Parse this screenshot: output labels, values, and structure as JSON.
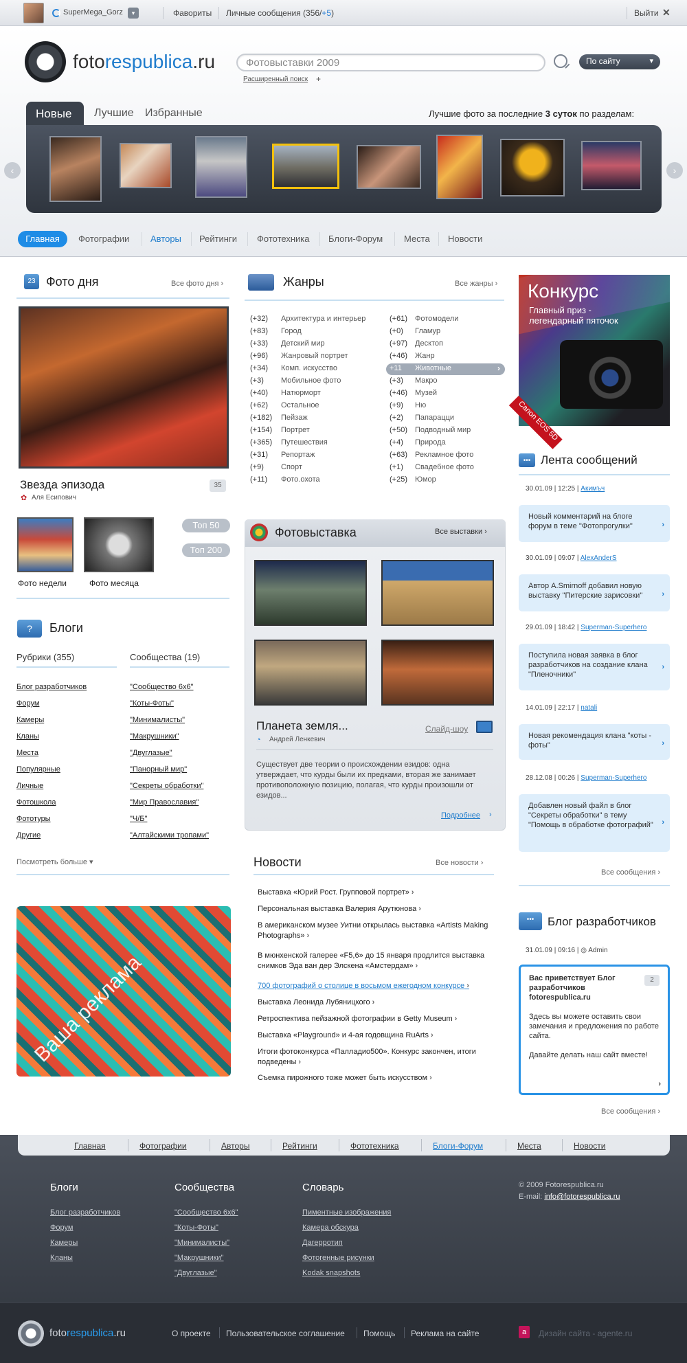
{
  "topbar": {
    "username": "SuperMega_Gorz",
    "favorites": "Фавориты",
    "messages_label": "Личные сообщения (356/",
    "messages_new": "+5",
    "messages_close": ")",
    "logout": "Выйти"
  },
  "header": {
    "logo_part1": "foto",
    "logo_part2": "respublica",
    "logo_part3": ".ru",
    "search_value": "Фотовыставки 2009",
    "scope": "По сайту",
    "advanced_search": "Расширенный поиск"
  },
  "gallery": {
    "tabs": [
      "Новые",
      "Лучшие",
      "Избранные"
    ],
    "caption_pre": "Лучшие фото за последние ",
    "caption_bold": "3 суток",
    "caption_post": " по разделам:"
  },
  "nav": {
    "items": [
      "Главная",
      "Фотографии",
      "Авторы",
      "Рейтинги",
      "Фототехника",
      "Блоги-Форум",
      "Места",
      "Новости"
    ]
  },
  "photo_day": {
    "icon_label": "23",
    "title": "Фото дня",
    "all_link": "Все фото дня",
    "photo_title": "Звезда эпизода",
    "author": "Аля Есипович",
    "comments": "35",
    "week": "Фото недели",
    "month": "Фото месяца",
    "top50": "Топ 50",
    "top200": "Топ 200"
  },
  "blogs": {
    "title": "Блоги",
    "rubrics_header": "Рубрики (355)",
    "communities_header": "Сообщества (19)",
    "rubrics": [
      "Блог разработчиков",
      "Форум",
      "Камеры",
      "Кланы",
      "Места",
      "Популярные",
      "Личные",
      "Фотошкола",
      "Фототуры",
      "Другие"
    ],
    "communities": [
      "\"Сообщество 6х6\"",
      "\"Коты-Фоты\"",
      "\"Минималисты\"",
      "\"Макрушники\"",
      "\"Двуглазые\"",
      "\"Панорный мир\"",
      "\"Секреты обработки\"",
      "\"Мир Православия\"",
      "\"Ч/Б\"",
      "\"Алтайскими тропами\""
    ],
    "more": "Посмотреть больше"
  },
  "genres": {
    "title": "Жанры",
    "all_link": "Все жанры",
    "left": [
      {
        "count": "(+32)",
        "name": "Архитектура и интерьер"
      },
      {
        "count": "(+83)",
        "name": "Город"
      },
      {
        "count": "(+33)",
        "name": "Детский мир"
      },
      {
        "count": "(+96)",
        "name": "Жанровый портрет"
      },
      {
        "count": "(+34)",
        "name": "Комп. искусство"
      },
      {
        "count": "(+3)",
        "name": "Мобильное фото"
      },
      {
        "count": "(+40)",
        "name": "Натюрморт"
      },
      {
        "count": "(+62)",
        "name": "Остальное"
      },
      {
        "count": "(+182)",
        "name": "Пейзаж"
      },
      {
        "count": "(+154)",
        "name": "Портрет"
      },
      {
        "count": "(+365)",
        "name": "Путешествия"
      },
      {
        "count": "(+31)",
        "name": "Репортаж"
      },
      {
        "count": "(+9)",
        "name": "Спорт"
      },
      {
        "count": "(+11)",
        "name": "Фото.охота"
      }
    ],
    "right": [
      {
        "count": "(+61)",
        "name": "Фотомодели"
      },
      {
        "count": "(+0)",
        "name": "Гламур"
      },
      {
        "count": "(+97)",
        "name": "Десктоп"
      },
      {
        "count": "(+46)",
        "name": "Жанр"
      },
      {
        "count": "+11",
        "name": "Животные"
      },
      {
        "count": "(+3)",
        "name": "Макро"
      },
      {
        "count": "(+46)",
        "name": "Музей"
      },
      {
        "count": "(+9)",
        "name": "Ню"
      },
      {
        "count": "(+2)",
        "name": "Папарацци"
      },
      {
        "count": "(+50)",
        "name": "Подводный мир"
      },
      {
        "count": "(+4)",
        "name": "Природа"
      },
      {
        "count": "(+63)",
        "name": "Рекламное фото"
      },
      {
        "count": "(+1)",
        "name": "Свадебное фото"
      },
      {
        "count": "(+25)",
        "name": "Юмор"
      }
    ]
  },
  "exhibition": {
    "title": "Фотовыставка",
    "all_link": "Все выставки",
    "name": "Планета земля...",
    "author": "Андрей Ленкевич",
    "slideshow": "Слайд-шоу",
    "text": "Существует две теории о происхождении езидов: одна утверждает, что курды были их предками, вторая же занимает противоположную позицию, полагая, что курды произошли от езидов...",
    "more": "Подробнее"
  },
  "news": {
    "title": "Новости",
    "all_link": "Все новости",
    "items": [
      "Выставка «Юрий Рост. Групповой портрет»",
      "Персональная выставка Валерия Арутюнова",
      "В американском музее Уитни открылась выставка «Artists Making Photographs»",
      "В мюнхенской галерее «F5,6» до 15 января продлится выставка снимков Эда ван дер Элскена «Амстердам»",
      "700 фотографий о столице в восьмом ежегодном конкурсе",
      "Выставка Леонида Лубяницкого",
      "Ретроспектива пейзажной фотографии в Getty Museum",
      "Выставка «Playground» и 4-ая годовщина RuArts",
      "Итоги фотоконкурса «Палладио500». Конкурс закончен, итоги подведены",
      "Съемка пирожного тоже может быть искусством"
    ]
  },
  "ad": {
    "title": "Конкурс",
    "subtitle": "Главный приз - легендарный пяточок",
    "ribbon": "Canon EOS 5D",
    "banner_text": "Ваша реклама"
  },
  "feed": {
    "title": "Лента сообщений",
    "messages": [
      {
        "date": "30.01.09",
        "time": "12:25",
        "user": "Акимъч",
        "text": "Новый комментарий на блоге форум в теме \"Фотопрогулки\""
      },
      {
        "date": "30.01.09",
        "time": "09:07",
        "user": "AlexAnderS",
        "text": "Автор A.Smirnoff добавил новую выставку \"Питерские зарисовки\""
      },
      {
        "date": "29.01.09",
        "time": "18:42",
        "user": "Superman-Superhero",
        "text": "Поступила новая заявка в блог разработчиков на создание клана \"Пленочники\""
      },
      {
        "date": "14.01.09",
        "time": "22:17",
        "user": "natali",
        "text": "Новая рекомендация клана \"коты - фоты\""
      },
      {
        "date": "28.12.08",
        "time": "00:26",
        "user": "Superman-Superhero",
        "text": "Добавлен новый файл в блог \"Секреты обработки\" в тему \"Помощь в обработке фотографий\""
      }
    ],
    "all_link": "Все сообщения"
  },
  "devblog": {
    "title": "Блог разработчиков",
    "date": "31.01.09",
    "time": "09:16",
    "author": "Admin",
    "heading": "Вас приветствует Блог разработчиков fotorespublica.ru",
    "count": "2",
    "p1": "Здесь вы можете оставить свои замечания и предложения по работе сайта.",
    "p2": "Давайте делать наш сайт вместе!",
    "all_link": "Все сообщения"
  },
  "footer": {
    "nav": [
      "Главная",
      "Фотографии",
      "Авторы",
      "Рейтинги",
      "Фототехника",
      "Блоги-Форум",
      "Места",
      "Новости"
    ],
    "col1_title": "Блоги",
    "col1": [
      "Блог разработчиков",
      "Форум",
      "Камеры",
      "Кланы"
    ],
    "col2_title": "Сообщества",
    "col2": [
      "\"Сообщество 6х6\"",
      "\"Коты-Фоты\"",
      "\"Минималисты\"",
      "\"Макрушники\"",
      "\"Двуглазые\""
    ],
    "col3_title": "Словарь",
    "col3": [
      "Пиментные изображения",
      "Камера обскура",
      "Дагерротип",
      "Фотогенные рисунки",
      "Kodak snapshots"
    ],
    "copyright": "© 2009 Fotorespublica.ru",
    "email_label": "E-mail: ",
    "email": "info@fotorespublica.ru",
    "bottom_links": [
      "О проекте",
      "Пользовательское соглашение",
      "Помощь",
      "Реклама на сайте"
    ],
    "designer": "Дизайн сайта - agente.ru"
  },
  "colors": {
    "accent": "#1e8ce6",
    "dark_panel": "#3a414b",
    "footer_bg": "#2f343c"
  }
}
